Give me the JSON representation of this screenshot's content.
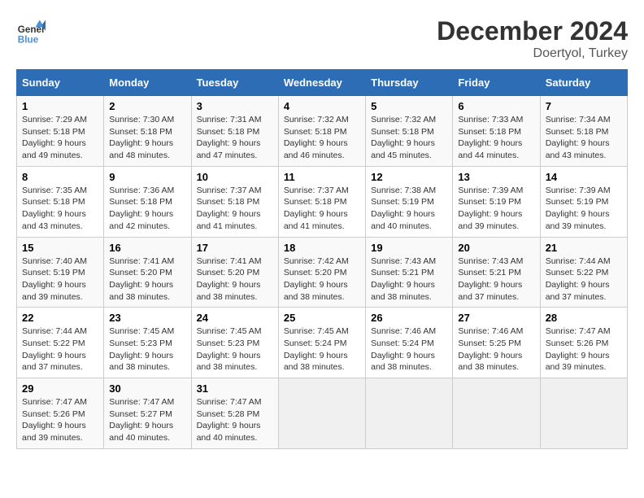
{
  "header": {
    "logo_line1": "General",
    "logo_line2": "Blue",
    "month_year": "December 2024",
    "location": "Doertyol, Turkey"
  },
  "columns": [
    "Sunday",
    "Monday",
    "Tuesday",
    "Wednesday",
    "Thursday",
    "Friday",
    "Saturday"
  ],
  "weeks": [
    [
      {
        "day": "1",
        "sunrise": "Sunrise: 7:29 AM",
        "sunset": "Sunset: 5:18 PM",
        "daylight": "Daylight: 9 hours and 49 minutes."
      },
      {
        "day": "2",
        "sunrise": "Sunrise: 7:30 AM",
        "sunset": "Sunset: 5:18 PM",
        "daylight": "Daylight: 9 hours and 48 minutes."
      },
      {
        "day": "3",
        "sunrise": "Sunrise: 7:31 AM",
        "sunset": "Sunset: 5:18 PM",
        "daylight": "Daylight: 9 hours and 47 minutes."
      },
      {
        "day": "4",
        "sunrise": "Sunrise: 7:32 AM",
        "sunset": "Sunset: 5:18 PM",
        "daylight": "Daylight: 9 hours and 46 minutes."
      },
      {
        "day": "5",
        "sunrise": "Sunrise: 7:32 AM",
        "sunset": "Sunset: 5:18 PM",
        "daylight": "Daylight: 9 hours and 45 minutes."
      },
      {
        "day": "6",
        "sunrise": "Sunrise: 7:33 AM",
        "sunset": "Sunset: 5:18 PM",
        "daylight": "Daylight: 9 hours and 44 minutes."
      },
      {
        "day": "7",
        "sunrise": "Sunrise: 7:34 AM",
        "sunset": "Sunset: 5:18 PM",
        "daylight": "Daylight: 9 hours and 43 minutes."
      }
    ],
    [
      {
        "day": "8",
        "sunrise": "Sunrise: 7:35 AM",
        "sunset": "Sunset: 5:18 PM",
        "daylight": "Daylight: 9 hours and 43 minutes."
      },
      {
        "day": "9",
        "sunrise": "Sunrise: 7:36 AM",
        "sunset": "Sunset: 5:18 PM",
        "daylight": "Daylight: 9 hours and 42 minutes."
      },
      {
        "day": "10",
        "sunrise": "Sunrise: 7:37 AM",
        "sunset": "Sunset: 5:18 PM",
        "daylight": "Daylight: 9 hours and 41 minutes."
      },
      {
        "day": "11",
        "sunrise": "Sunrise: 7:37 AM",
        "sunset": "Sunset: 5:18 PM",
        "daylight": "Daylight: 9 hours and 41 minutes."
      },
      {
        "day": "12",
        "sunrise": "Sunrise: 7:38 AM",
        "sunset": "Sunset: 5:19 PM",
        "daylight": "Daylight: 9 hours and 40 minutes."
      },
      {
        "day": "13",
        "sunrise": "Sunrise: 7:39 AM",
        "sunset": "Sunset: 5:19 PM",
        "daylight": "Daylight: 9 hours and 39 minutes."
      },
      {
        "day": "14",
        "sunrise": "Sunrise: 7:39 AM",
        "sunset": "Sunset: 5:19 PM",
        "daylight": "Daylight: 9 hours and 39 minutes."
      }
    ],
    [
      {
        "day": "15",
        "sunrise": "Sunrise: 7:40 AM",
        "sunset": "Sunset: 5:19 PM",
        "daylight": "Daylight: 9 hours and 39 minutes."
      },
      {
        "day": "16",
        "sunrise": "Sunrise: 7:41 AM",
        "sunset": "Sunset: 5:20 PM",
        "daylight": "Daylight: 9 hours and 38 minutes."
      },
      {
        "day": "17",
        "sunrise": "Sunrise: 7:41 AM",
        "sunset": "Sunset: 5:20 PM",
        "daylight": "Daylight: 9 hours and 38 minutes."
      },
      {
        "day": "18",
        "sunrise": "Sunrise: 7:42 AM",
        "sunset": "Sunset: 5:20 PM",
        "daylight": "Daylight: 9 hours and 38 minutes."
      },
      {
        "day": "19",
        "sunrise": "Sunrise: 7:43 AM",
        "sunset": "Sunset: 5:21 PM",
        "daylight": "Daylight: 9 hours and 38 minutes."
      },
      {
        "day": "20",
        "sunrise": "Sunrise: 7:43 AM",
        "sunset": "Sunset: 5:21 PM",
        "daylight": "Daylight: 9 hours and 37 minutes."
      },
      {
        "day": "21",
        "sunrise": "Sunrise: 7:44 AM",
        "sunset": "Sunset: 5:22 PM",
        "daylight": "Daylight: 9 hours and 37 minutes."
      }
    ],
    [
      {
        "day": "22",
        "sunrise": "Sunrise: 7:44 AM",
        "sunset": "Sunset: 5:22 PM",
        "daylight": "Daylight: 9 hours and 37 minutes."
      },
      {
        "day": "23",
        "sunrise": "Sunrise: 7:45 AM",
        "sunset": "Sunset: 5:23 PM",
        "daylight": "Daylight: 9 hours and 38 minutes."
      },
      {
        "day": "24",
        "sunrise": "Sunrise: 7:45 AM",
        "sunset": "Sunset: 5:23 PM",
        "daylight": "Daylight: 9 hours and 38 minutes."
      },
      {
        "day": "25",
        "sunrise": "Sunrise: 7:45 AM",
        "sunset": "Sunset: 5:24 PM",
        "daylight": "Daylight: 9 hours and 38 minutes."
      },
      {
        "day": "26",
        "sunrise": "Sunrise: 7:46 AM",
        "sunset": "Sunset: 5:24 PM",
        "daylight": "Daylight: 9 hours and 38 minutes."
      },
      {
        "day": "27",
        "sunrise": "Sunrise: 7:46 AM",
        "sunset": "Sunset: 5:25 PM",
        "daylight": "Daylight: 9 hours and 38 minutes."
      },
      {
        "day": "28",
        "sunrise": "Sunrise: 7:47 AM",
        "sunset": "Sunset: 5:26 PM",
        "daylight": "Daylight: 9 hours and 39 minutes."
      }
    ],
    [
      {
        "day": "29",
        "sunrise": "Sunrise: 7:47 AM",
        "sunset": "Sunset: 5:26 PM",
        "daylight": "Daylight: 9 hours and 39 minutes."
      },
      {
        "day": "30",
        "sunrise": "Sunrise: 7:47 AM",
        "sunset": "Sunset: 5:27 PM",
        "daylight": "Daylight: 9 hours and 40 minutes."
      },
      {
        "day": "31",
        "sunrise": "Sunrise: 7:47 AM",
        "sunset": "Sunset: 5:28 PM",
        "daylight": "Daylight: 9 hours and 40 minutes."
      },
      null,
      null,
      null,
      null
    ]
  ]
}
